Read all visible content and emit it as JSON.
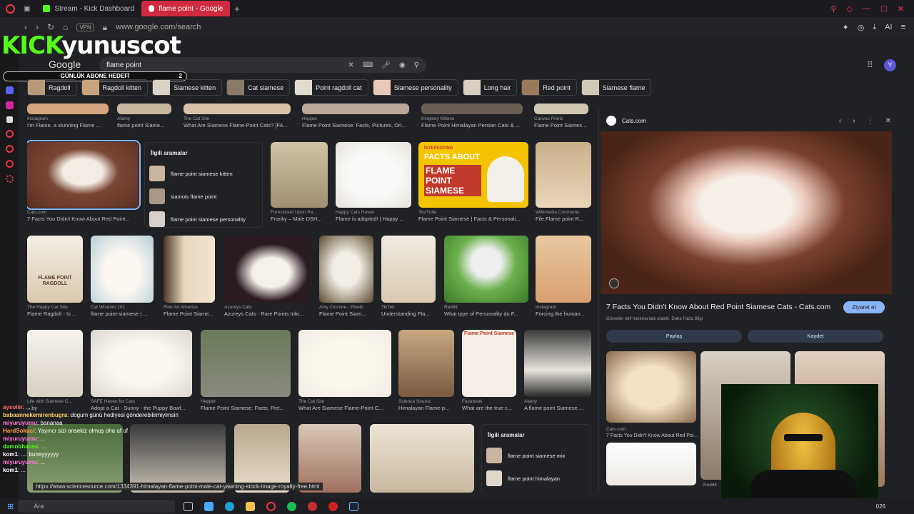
{
  "browser": {
    "tabs": [
      {
        "label": "Stream - Kick Dashboard",
        "active": false,
        "color": "#53fc18"
      },
      {
        "label": "flame point - Google'da A",
        "active": true,
        "color": "#ffffff"
      }
    ],
    "vpn": "VPN",
    "url": "www.google.com/search"
  },
  "stream_overlay": {
    "brand": "KICK",
    "channel": "yunuscot",
    "goal_label": "GÜNLÜK ABONE HEDEFİ",
    "goal_count": "2"
  },
  "search": {
    "logo": "Google",
    "query": "flame point"
  },
  "account_initial": "Y",
  "chips": [
    {
      "label": "Ragdoll"
    },
    {
      "label": "Ragdoll kitten"
    },
    {
      "label": "Siamese kitten"
    },
    {
      "label": "Cat siamese"
    },
    {
      "label": "Point ragdoll cat"
    },
    {
      "label": "Siamese personality"
    },
    {
      "label": "Long hair"
    },
    {
      "label": "Red point"
    },
    {
      "label": "Siamese flame"
    }
  ],
  "row0": [
    {
      "src": "Instagram",
      "cap": "I'm Flame, a stunning Flame ..."
    },
    {
      "src": "Alamy",
      "cap": "flame point Siame..."
    },
    {
      "src": "The Cat Site",
      "cap": "What Are Siamese Flame-Point Cats? [FA..."
    },
    {
      "src": "Hepper",
      "cap": "Flame Point Siamese: Facts, Pictures, Ori..."
    },
    {
      "src": "Kingsley Kittens",
      "cap": "Flame Point Himalayan Persian Cats & ..."
    },
    {
      "src": "Canvas Prints",
      "cap": "Flame Point Siames..."
    }
  ],
  "row1": [
    {
      "src": "Cats.com",
      "cap": "7 Facts You Didn't Know About Red Point..."
    },
    {
      "src": "Foreclosed Upon Pe...",
      "cap": "Franky – Male DSH..."
    },
    {
      "src": "Happy Cats Haven",
      "cap": "Flame is adopted! | Happy ..."
    },
    {
      "src": "YouTube",
      "cap": "Flame Point Siamese | Facts & Personali..."
    },
    {
      "src": "Wikimedia Commons",
      "cap": "File:Flame point R..."
    }
  ],
  "thumb_text": {
    "facts_top": "INTERESTING",
    "facts_main": "FACTS ABOUT",
    "facts_big": "FLAME POINT SIAMESE",
    "ragdoll": "FLAME POINT RAGDOLL"
  },
  "related1": {
    "heading": "İlgili aramalar",
    "items": [
      {
        "label": "flame point siamese kitten"
      },
      {
        "label": "siamois flame point"
      },
      {
        "label": "flame point siamese personality"
      }
    ]
  },
  "row2": [
    {
      "src": "The Happy Cat Site",
      "cap": "Flame Ragdoll - Is ..."
    },
    {
      "src": "Cat Wisdom 101",
      "cap": "flame point-siamese | ..."
    },
    {
      "src": "Fine Art America",
      "cap": "Flame Point Siame..."
    },
    {
      "src": "Azureys Cats",
      "cap": "Azureys Cats - Rare Points Info..."
    },
    {
      "src": "Amy Ciccone - Pixels",
      "cap": "Flame Point Siam..."
    },
    {
      "src": "TikTok",
      "cap": "Understanding Fla..."
    },
    {
      "src": "Reddit",
      "cap": "What type of Personality do F..."
    },
    {
      "src": "Instagram",
      "cap": "Forcing the human..."
    }
  ],
  "row3": [
    {
      "src": "Life with Siamese C...",
      "cap": "...by"
    },
    {
      "src": "SAFE Haven for Cats",
      "cap": "Adopt a Cat - Sunny - the Puppy Bowl..."
    },
    {
      "src": "Hepper",
      "cap": "Flame Point Siamese: Facts, Pict..."
    },
    {
      "src": "The Cat Site",
      "cap": "What Are Siamese Flame-Point C..."
    },
    {
      "src": "Science Source",
      "cap": "Himalayan Flame-p..."
    },
    {
      "src": "Facebook",
      "cap": "What are the true c..."
    },
    {
      "src": "Alamy",
      "cap": "A flame point Siamese ..."
    }
  ],
  "poster_title": "Flame Point Siamese",
  "related2": {
    "heading": "İlgili aramalar",
    "items": [
      {
        "label": "flame point siamese mix"
      },
      {
        "label": "flame point himalayan"
      }
    ]
  },
  "panel": {
    "site": "Cats.com",
    "title": "7 Facts You Didn't Know About Red Point Siamese Cats - Cats.com",
    "visit": "Ziyaret et",
    "note": "Görseller telif hakkına tabi olabilir. Daha Fazla Bilgi",
    "share": "Paylaş",
    "save": "Kaydet",
    "more_src": "Cats.com",
    "more_cap": "7 Facts You Didn't Know About Red Poi...",
    "more_src2": "Reddit"
  },
  "chat": [
    {
      "user": "aysolin",
      "text": "...",
      "color": "#ff6b6b"
    },
    {
      "user": "babaannekemirenbugra",
      "text": "dogum günü hediyesi gönderebilirmiyimsin",
      "color": "#ffd166"
    },
    {
      "user": "miyuruyumu",
      "text": "bananaa",
      "color": "#ff7ad9"
    },
    {
      "user": "HardSokuci",
      "text": "Yayıncı sizi onsekiz olmuş oha uf uf",
      "color": "#ff9f43"
    },
    {
      "user": "miyuruyumu",
      "text": "...",
      "color": "#ff7ad9"
    },
    {
      "user": "damnbhaoss",
      "text": "...",
      "color": "#53fc18"
    },
    {
      "user": "kom1",
      "text": "...: buneyyyyyy",
      "color": "#ffffff"
    },
    {
      "user": "miyuruyumu",
      "text": "...",
      "color": "#ff7ad9"
    },
    {
      "user": "kom1",
      "text": "...",
      "color": "#ffffff"
    }
  ],
  "status_url": "https://www.sciencesource.com/1334391-himalayan-flame-point-male-cat-yawning-stock-image-royalty-free.html",
  "taskbar": {
    "search_placeholder": "Ara",
    "time": "026"
  }
}
